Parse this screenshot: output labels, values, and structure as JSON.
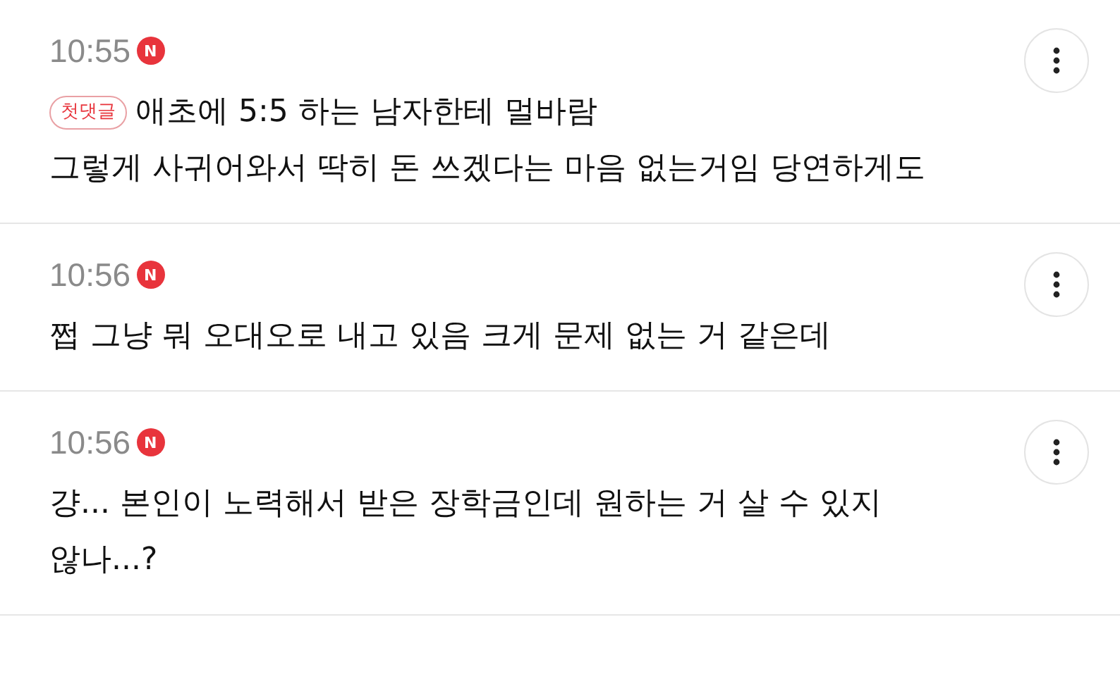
{
  "comments": [
    {
      "time": "10:55",
      "new_badge": "N",
      "label": "첫댓글",
      "lines": [
        "애초에 5:5 하는 남자한테 멀바람",
        "그렇게 사귀어와서 딱히 돈 쓰겠다는 마음 없는거임 당연하게도"
      ]
    },
    {
      "time": "10:56",
      "new_badge": "N",
      "lines": [
        "쩝 그냥 뭐 오대오로 내고 있음 크게 문제 없는 거 같은데"
      ]
    },
    {
      "time": "10:56",
      "new_badge": "N",
      "lines": [
        "걍... 본인이 노력해서 받은 장학금인데 원하는 거 살 수 있지",
        "않나...?"
      ]
    }
  ]
}
